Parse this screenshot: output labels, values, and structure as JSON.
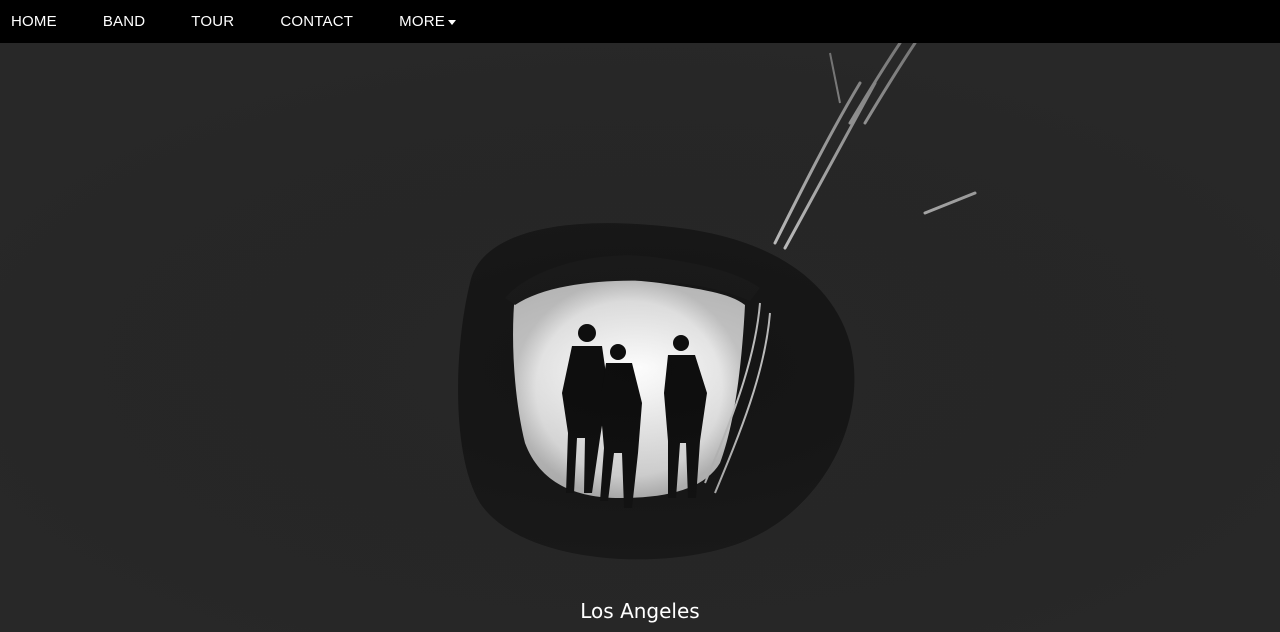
{
  "nav": {
    "items": [
      {
        "label": "HOME"
      },
      {
        "label": "BAND"
      },
      {
        "label": "TOUR"
      },
      {
        "label": "CONTACT"
      },
      {
        "label": "MORE"
      }
    ]
  },
  "hero": {
    "image_icon": "tunnel-silhouette-photo",
    "caption": "Los Angeles"
  },
  "colors": {
    "navbar_bg": "#000000",
    "page_bg": "#282828",
    "text": "#ffffff"
  }
}
